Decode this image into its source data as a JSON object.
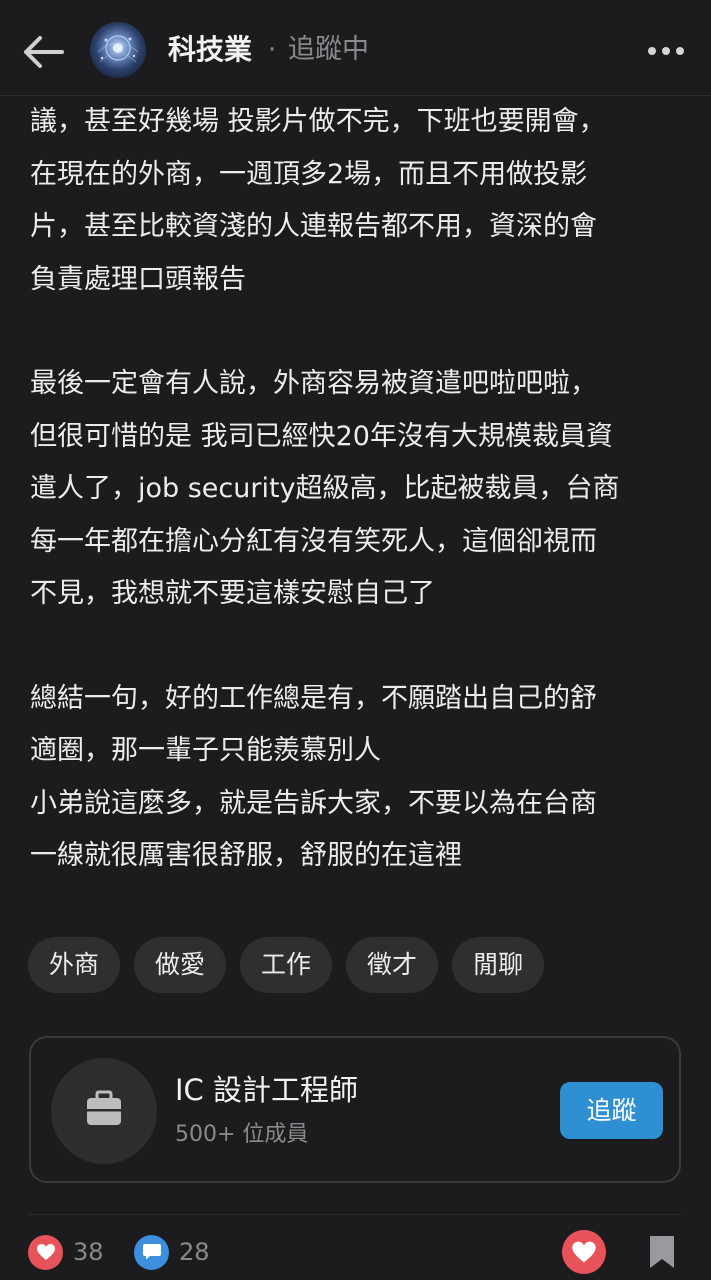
{
  "header": {
    "board_name": "科技業",
    "separator": "·",
    "follow_status": "追蹤中"
  },
  "post": {
    "paragraphs": [
      {
        "lines": [
          "議，甚至好幾場 投影片做不完，下班也要開會，",
          "在現在的外商，一週頂多2場，而且不用做投影",
          "片，甚至比較資淺的人連報告都不用，資深的會",
          "負責處理口頭報告"
        ]
      },
      {
        "lines": [
          "最後一定會有人說，外商容易被資遣吧啦吧啦，",
          "但很可惜的是 我司已經快20年沒有大規模裁員資",
          "遣人了，job security超級高，比起被裁員，台商",
          "每一年都在擔心分紅有沒有笑死人，這個卻視而",
          "不見，我想就不要這樣安慰自己了"
        ]
      },
      {
        "lines": [
          "總結一句，好的工作總是有，不願踏出自己的舒",
          "適圈，那一輩子只能羨慕別人",
          "小弟說這麼多，就是告訴大家，不要以為在台商",
          "一線就很厲害很舒服，舒服的在這裡"
        ]
      }
    ],
    "tags": [
      "外商",
      "做愛",
      "工作",
      "徵才",
      "閒聊"
    ]
  },
  "board_card": {
    "icon": "briefcase-icon",
    "title": "IC 設計工程師",
    "members": "500+ 位成員",
    "follow_label": "追蹤"
  },
  "footer": {
    "like_count": "38",
    "comment_count": "28"
  },
  "colors": {
    "background": "#1c1c1e",
    "accent_blue": "#2f8fd3",
    "like_red": "#e8535a",
    "comment_blue": "#3d8fe0"
  }
}
